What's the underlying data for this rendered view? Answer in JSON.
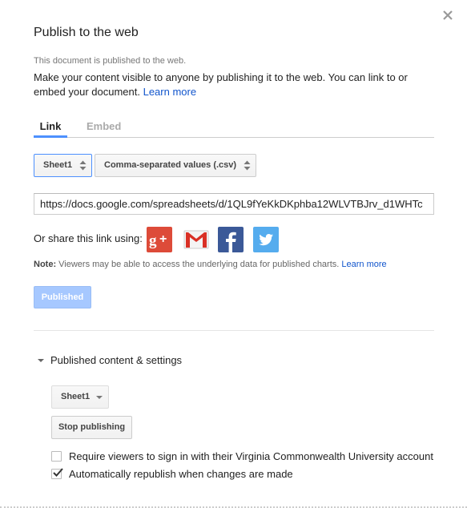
{
  "dialog": {
    "title": "Publish to the web",
    "close_icon": "close-icon"
  },
  "status_text": "This document is published to the web.",
  "description": "Make your content visible to anyone by publishing it to the web. You can link to or embed your document.",
  "learn_more": "Learn more",
  "tabs": [
    {
      "label": "Link",
      "active": true
    },
    {
      "label": "Embed",
      "active": false
    }
  ],
  "sheet_select": {
    "value": "Sheet1"
  },
  "format_select": {
    "value": "Comma-separated values (.csv)"
  },
  "url_field": {
    "value": "https://docs.google.com/spreadsheets/d/1QL9fYeKkDKphba12WLVTBJrv_d1WHTc"
  },
  "share": {
    "label": "Or share this link using:",
    "icons": [
      "google-plus-icon",
      "gmail-icon",
      "facebook-icon",
      "twitter-icon"
    ]
  },
  "note": {
    "bold": "Note:",
    "text": " Viewers may be able to access the underlying data for published charts.",
    "link": "Learn more"
  },
  "published_button": "Published",
  "settings": {
    "heading": "Published content & settings",
    "sheet_dropdown": "Sheet1",
    "stop_button": "Stop publishing",
    "require_signin": {
      "label": "Require viewers to sign in with their Virginia Commonwealth University account",
      "checked": false
    },
    "auto_republish": {
      "label": "Automatically republish when changes are made",
      "checked": true
    }
  },
  "colors": {
    "accent": "#4d90fe",
    "link": "#1155cc",
    "published_bg": "#a6c8ff",
    "gplus": "#dd4b39",
    "facebook": "#3b5998",
    "twitter": "#55acee"
  }
}
